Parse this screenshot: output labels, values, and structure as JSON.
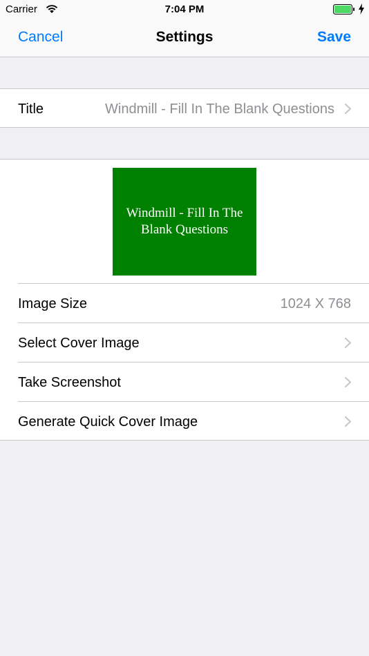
{
  "status_bar": {
    "carrier": "Carrier",
    "time": "7:04 PM"
  },
  "nav": {
    "cancel_label": "Cancel",
    "title": "Settings",
    "save_label": "Save"
  },
  "title_row": {
    "label": "Title",
    "value": "Windmill - Fill In The Blank Questions"
  },
  "cover": {
    "preview_text": "Windmill - Fill In The Blank Questions",
    "preview_color": "#008000"
  },
  "rows": [
    {
      "label": "Image Size",
      "value": "1024 X 768"
    },
    {
      "label": "Select Cover Image"
    },
    {
      "label": "Take Screenshot"
    },
    {
      "label": "Generate Quick Cover Image"
    }
  ],
  "colors": {
    "accent": "#007aff",
    "background": "#efeff4",
    "secondary_text": "#8e8e93",
    "separator": "#c8c7cc",
    "battery": "#4cd964"
  }
}
